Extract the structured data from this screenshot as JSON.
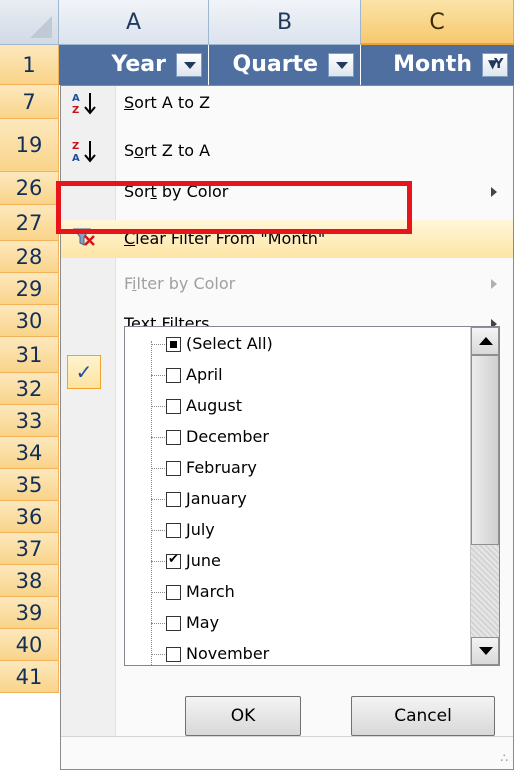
{
  "columns": [
    {
      "label": "A",
      "selected": false
    },
    {
      "label": "B",
      "selected": false
    },
    {
      "label": "C",
      "selected": true
    }
  ],
  "rows": [
    "1",
    "7",
    "19",
    "26",
    "27",
    "28",
    "29",
    "30",
    "31",
    "32",
    "33",
    "34",
    "35",
    "36",
    "37",
    "38",
    "39",
    "40",
    "41"
  ],
  "header_row": {
    "year": "Year",
    "quarter": "Quarte",
    "month": "Month"
  },
  "menu": {
    "sort_a_z": {
      "pre": "",
      "u": "S",
      "post": "ort A to Z"
    },
    "sort_z_a": {
      "pre": "S",
      "u": "o",
      "post": "rt Z to A"
    },
    "sort_color": {
      "pre": "Sor",
      "u": "t",
      "post": " by Color"
    },
    "clear_filter": {
      "pre": "",
      "u": "C",
      "post": "lear Filter From \"Month\""
    },
    "filter_color": {
      "pre": "F",
      "u": "i",
      "post": "lter by Color"
    },
    "text_filters": {
      "pre": "Text ",
      "u": "F",
      "post": "ilters"
    }
  },
  "list": {
    "items": [
      {
        "label": "(Select All)",
        "state": "mixed"
      },
      {
        "label": "April",
        "state": "unchecked"
      },
      {
        "label": "August",
        "state": "unchecked"
      },
      {
        "label": "December",
        "state": "unchecked"
      },
      {
        "label": "February",
        "state": "unchecked"
      },
      {
        "label": "January",
        "state": "unchecked"
      },
      {
        "label": "July",
        "state": "unchecked"
      },
      {
        "label": "June",
        "state": "checked"
      },
      {
        "label": "March",
        "state": "unchecked"
      },
      {
        "label": "May",
        "state": "unchecked"
      },
      {
        "label": "November",
        "state": "unchecked"
      }
    ]
  },
  "buttons": {
    "ok": "OK",
    "cancel": "Cancel"
  },
  "icons": {
    "sort_asc": "sort-a-z-icon",
    "sort_desc": "sort-z-a-icon",
    "clear_filter": "clear-filter-icon",
    "filter_check": "check-icon"
  },
  "colors": {
    "highlight_box": "#e8141c",
    "header_bg": "#4f6fa0",
    "row_header": "#f9d48a"
  }
}
